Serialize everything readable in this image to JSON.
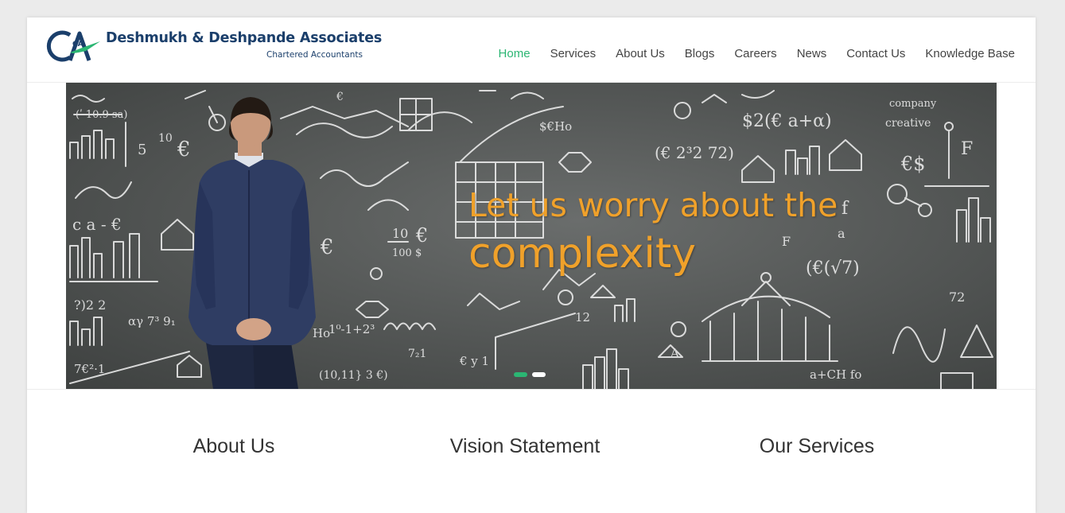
{
  "header": {
    "logo_initials": "CA",
    "logo_name": "Deshmukh & Deshpande Associates",
    "logo_tagline": "Chartered Accountants",
    "nav": [
      {
        "label": "Home",
        "active": true
      },
      {
        "label": "Services",
        "active": false
      },
      {
        "label": "About Us",
        "active": false
      },
      {
        "label": "Blogs",
        "active": false
      },
      {
        "label": "Careers",
        "active": false
      },
      {
        "label": "News",
        "active": false
      },
      {
        "label": "Contact Us",
        "active": false
      },
      {
        "label": "Knowledge Base",
        "active": false
      }
    ]
  },
  "hero": {
    "caption_line1": "Let us worry about the",
    "caption_line2": "complexity",
    "slides": 2,
    "active_slide": 1
  },
  "sections": [
    {
      "title": "About Us"
    },
    {
      "title": "Vision Statement"
    },
    {
      "title": "Our Services"
    }
  ],
  "colors": {
    "accent_green": "#2bb673",
    "caption_orange": "#f0a12a",
    "logo_blue": "#1b3f6b",
    "background": "#ebebeb"
  }
}
